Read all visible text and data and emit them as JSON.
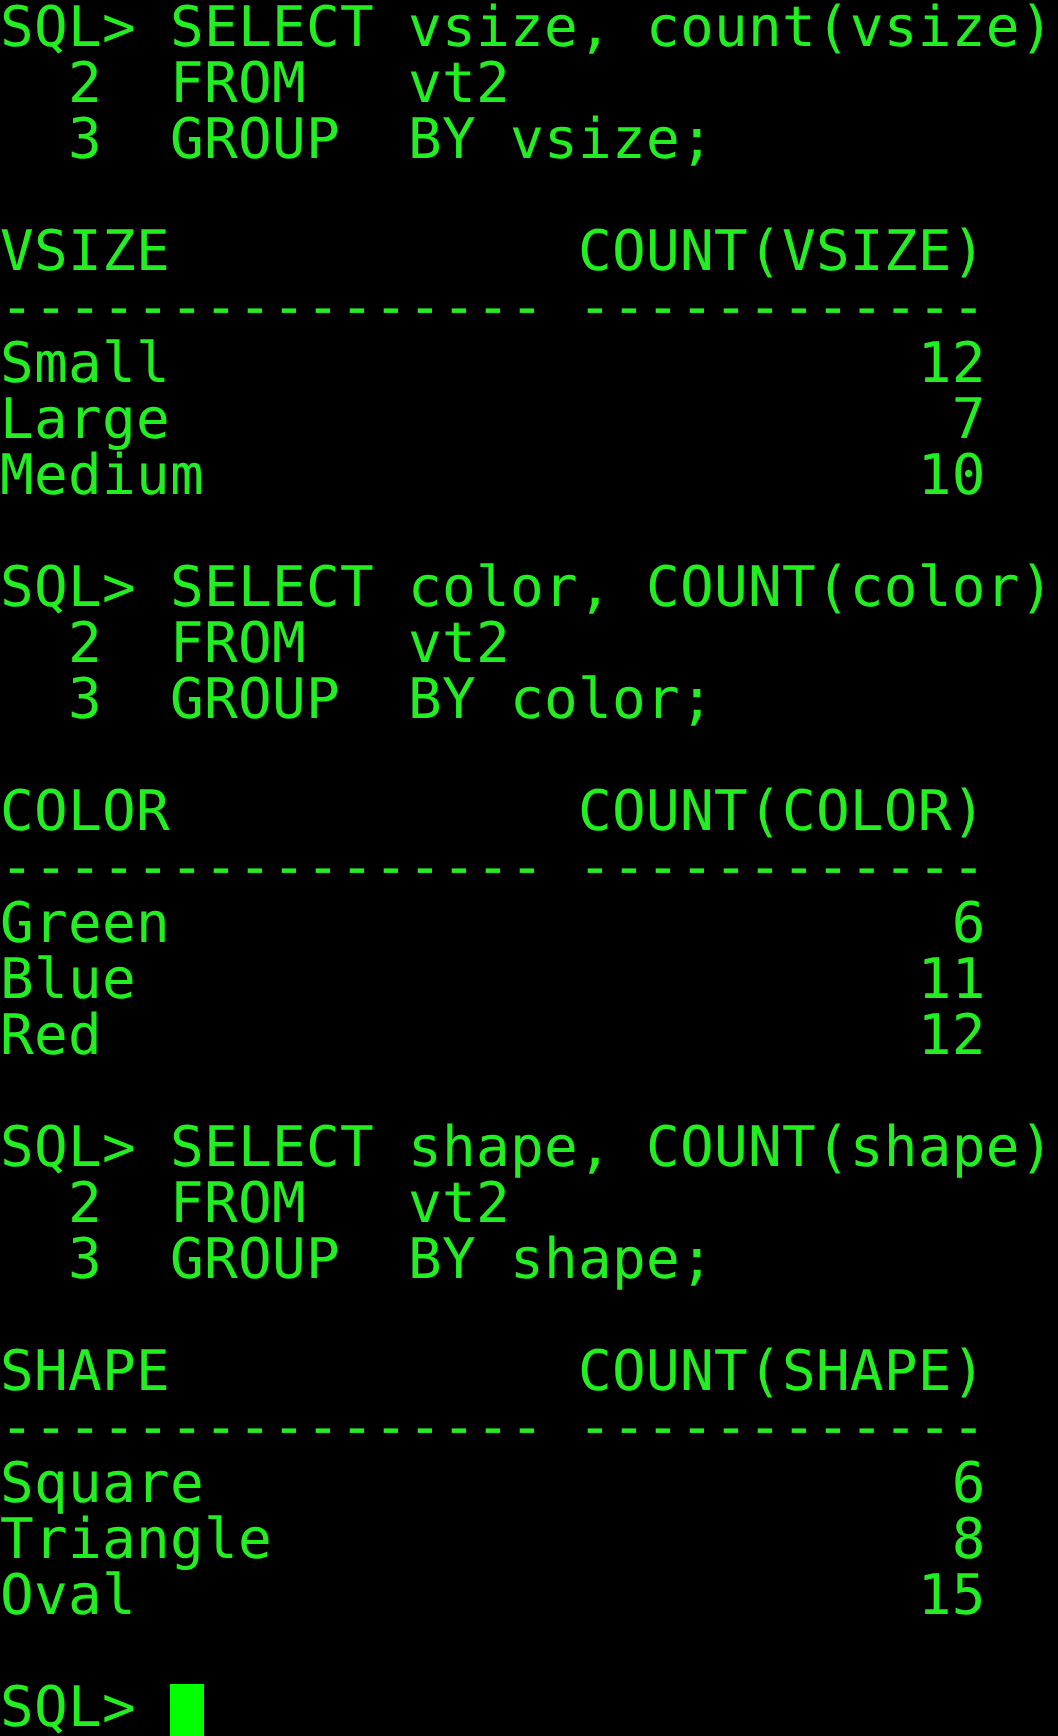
{
  "terminal": {
    "lines": [
      {
        "kind": "text",
        "text": "SQL> SELECT vsize, count(vsize)"
      },
      {
        "kind": "text",
        "text": "  2  FROM   vt2"
      },
      {
        "kind": "text",
        "text": "  3  GROUP  BY vsize;"
      },
      {
        "kind": "blank"
      },
      {
        "kind": "text",
        "text": "VSIZE            COUNT(VSIZE)"
      },
      {
        "kind": "text",
        "text": "---------------- ------------"
      },
      {
        "kind": "text",
        "text": "Small                      12"
      },
      {
        "kind": "text",
        "text": "Large                       7"
      },
      {
        "kind": "text",
        "text": "Medium                     10"
      },
      {
        "kind": "blank"
      },
      {
        "kind": "text",
        "text": "SQL> SELECT color, COUNT(color)"
      },
      {
        "kind": "text",
        "text": "  2  FROM   vt2"
      },
      {
        "kind": "text",
        "text": "  3  GROUP  BY color;"
      },
      {
        "kind": "blank"
      },
      {
        "kind": "text",
        "text": "COLOR            COUNT(COLOR)"
      },
      {
        "kind": "text",
        "text": "---------------- ------------"
      },
      {
        "kind": "text",
        "text": "Green                       6"
      },
      {
        "kind": "text",
        "text": "Blue                       11"
      },
      {
        "kind": "text",
        "text": "Red                        12"
      },
      {
        "kind": "blank"
      },
      {
        "kind": "text",
        "text": "SQL> SELECT shape, COUNT(shape)"
      },
      {
        "kind": "text",
        "text": "  2  FROM   vt2"
      },
      {
        "kind": "text",
        "text": "  3  GROUP  BY shape;"
      },
      {
        "kind": "blank"
      },
      {
        "kind": "text",
        "text": "SHAPE            COUNT(SHAPE)"
      },
      {
        "kind": "text",
        "text": "---------------- ------------"
      },
      {
        "kind": "text",
        "text": "Square                      6"
      },
      {
        "kind": "text",
        "text": "Triangle                    8"
      },
      {
        "kind": "text",
        "text": "Oval                       15"
      },
      {
        "kind": "blank"
      },
      {
        "kind": "prompt",
        "text": "SQL>"
      }
    ]
  }
}
